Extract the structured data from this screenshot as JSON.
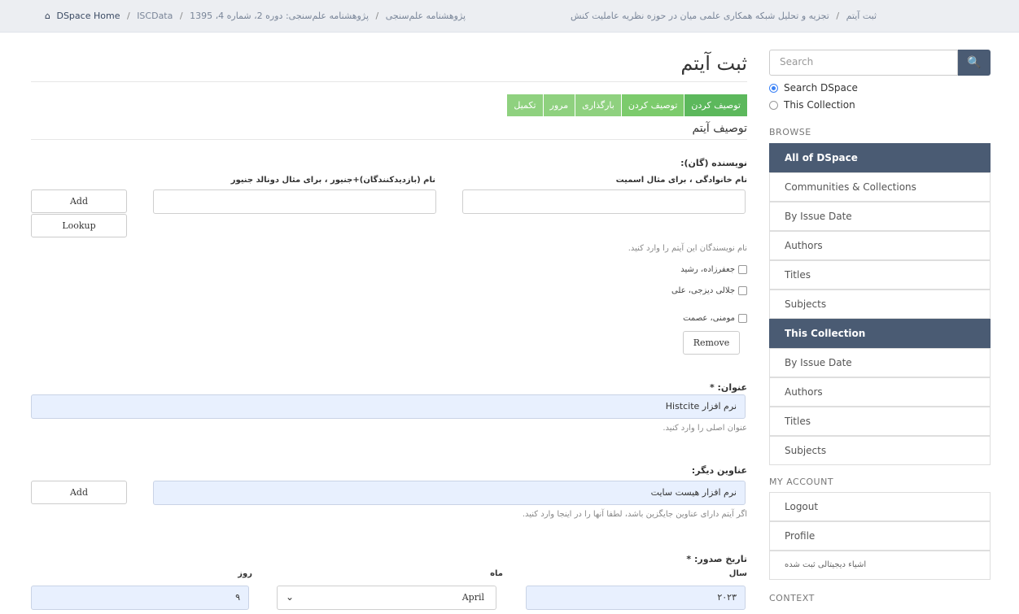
{
  "breadcrumb": {
    "home_icon": "home-icon",
    "home": "DSpace Home",
    "items": [
      "ISCData",
      "پژوهشنامه علم‌سنجی",
      "پژوهشنامه علم‌سنجی: دوره 2، شماره 4، 1395"
    ],
    "right_items": [
      "ثبت آیتم",
      "تجزیه و تحلیل شبکه همکاری علمی میان در حوزه نظریه عاملیت کنش"
    ],
    "separator": "/"
  },
  "page": {
    "title": "ثبت آیتم",
    "section_title": "توصیف آیتم"
  },
  "steps": [
    {
      "label": "توصیف کردن",
      "state": "active"
    },
    {
      "label": "توصیف کردن",
      "state": "done"
    },
    {
      "label": "بارگذاری",
      "state": "todo"
    },
    {
      "label": "مرور",
      "state": "todo"
    },
    {
      "label": "تکمیل",
      "state": "todo"
    }
  ],
  "authors": {
    "label": "نویسنده (گان):",
    "last_name_label": "نام خانوادگی ، برای مثال اسمیت",
    "first_name_label": "نام (بازدیدکنندگان)+جنیور ، برای مثال دونالد جنیور",
    "last_name_value": "",
    "first_name_value": "",
    "add_button": "Add",
    "lookup_button": "Lookup",
    "help": "نام نویسندگان این آیتم را وارد کنید.",
    "list": [
      "جعفرزاده، رشید",
      "جلالی دیزجی، علی",
      "مومنی، عصمت"
    ],
    "remove_button": "Remove"
  },
  "title_field": {
    "label": "عنوان: *",
    "value": "نرم افزار Histcite",
    "help": "عنوان اصلی را وارد کنید."
  },
  "other_titles": {
    "label": "عناوین دیگر:",
    "value": "نرم افزار هیست سایت",
    "add_button": "Add",
    "help": "اگر آیتم دارای عناوین جایگزین باشد، لطفا آنها را در اینجا وارد کنید."
  },
  "issue_date": {
    "label": "تاریخ صدور: *",
    "year_label": "سال",
    "month_label": "ماه",
    "day_label": "روز",
    "year_value": "۲۰۲۳",
    "month_value": "April",
    "day_value": "۹"
  },
  "sidebar": {
    "search_placeholder": "Search",
    "search_icon": "search-icon",
    "scope_options": [
      "Search DSpace",
      "This Collection"
    ],
    "browse_heading": "BROWSE",
    "browse_all_heading": "All of DSpace",
    "browse_all_items": [
      "Communities & Collections",
      "By Issue Date",
      "Authors",
      "Titles",
      "Subjects"
    ],
    "collection_heading": "This Collection",
    "collection_items": [
      "By Issue Date",
      "Authors",
      "Titles",
      "Subjects"
    ],
    "account_heading": "MY ACCOUNT",
    "account_items": [
      "Logout",
      "Profile",
      "اشیاء دیجیتالی ثبت شده"
    ],
    "context_heading": "CONTEXT"
  },
  "colors": {
    "step_active": "#5cb85c",
    "step_todo": "#8fd17f",
    "sidebar_active": "#4a5b73",
    "input_filled": "#e8f0fe"
  }
}
